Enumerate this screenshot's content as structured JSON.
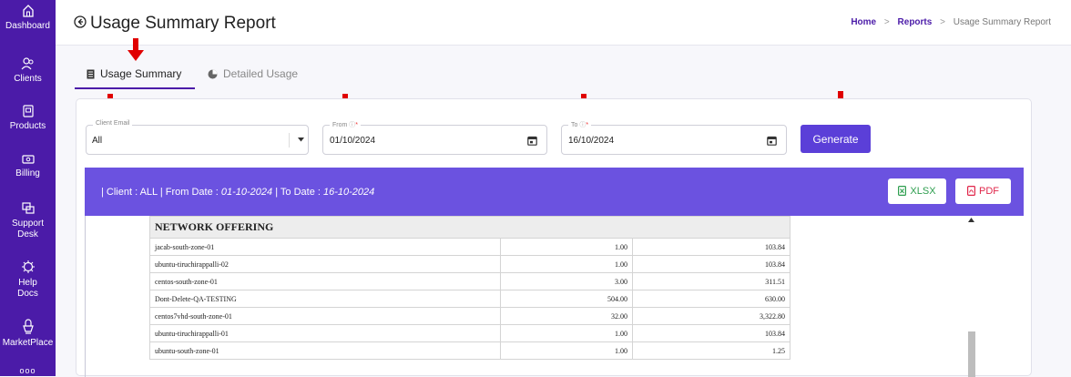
{
  "sidebar": {
    "items": [
      {
        "label": "Dashboard",
        "icon": "home-icon"
      },
      {
        "label": "Clients",
        "icon": "users-icon"
      },
      {
        "label": "Products",
        "icon": "products-icon"
      },
      {
        "label": "Billing",
        "icon": "billing-icon"
      },
      {
        "label": "Support",
        "label2": "Desk",
        "icon": "support-icon"
      },
      {
        "label": "Help",
        "label2": "Docs",
        "icon": "help-icon"
      },
      {
        "label": "MarketPlace",
        "icon": "marketplace-icon"
      },
      {
        "label": "ooo",
        "icon": "more-icon"
      }
    ]
  },
  "header": {
    "title": "Usage Summary Report",
    "breadcrumb": [
      "Home",
      "Reports",
      "Usage Summary Report"
    ]
  },
  "tabs": [
    {
      "label": "Usage Summary",
      "active": true
    },
    {
      "label": "Detailed Usage",
      "active": false
    }
  ],
  "filters": {
    "client_email": {
      "label": "Client Email",
      "value": "All"
    },
    "from": {
      "label": "From",
      "value": "01/10/2024"
    },
    "to": {
      "label": "To",
      "value": "16/10/2024"
    },
    "generate_label": "Generate"
  },
  "banner": {
    "prefix": "| Client : ALL | From Date : ",
    "from_date": "01-10-2024",
    "mid": " | To Date : ",
    "to_date": "16-10-2024",
    "xlsx_label": "XLSX",
    "pdf_label": "PDF"
  },
  "table": {
    "section_header": "NETWORK OFFERING",
    "rows": [
      {
        "name": "jacab-south-zone-01",
        "qty": "1.00",
        "cost": "103.84"
      },
      {
        "name": "ubuntu-tiruchirappalli-02",
        "qty": "1.00",
        "cost": "103.84"
      },
      {
        "name": "centos-south-zone-01",
        "qty": "3.00",
        "cost": "311.51"
      },
      {
        "name": "Dont-Delete-QA-TESTING",
        "qty": "504.00",
        "cost": "630.00"
      },
      {
        "name": "centos7vhd-south-zone-01",
        "qty": "32.00",
        "cost": "3,322.80"
      },
      {
        "name": "ubuntu-tiruchirappalli-01",
        "qty": "1.00",
        "cost": "103.84"
      },
      {
        "name": "ubuntu-south-zone-01",
        "qty": "1.00",
        "cost": "1.25"
      }
    ]
  },
  "colors": {
    "brand": "#4b1ba8",
    "banner": "#6b52e0",
    "arrow": "#e00000"
  }
}
